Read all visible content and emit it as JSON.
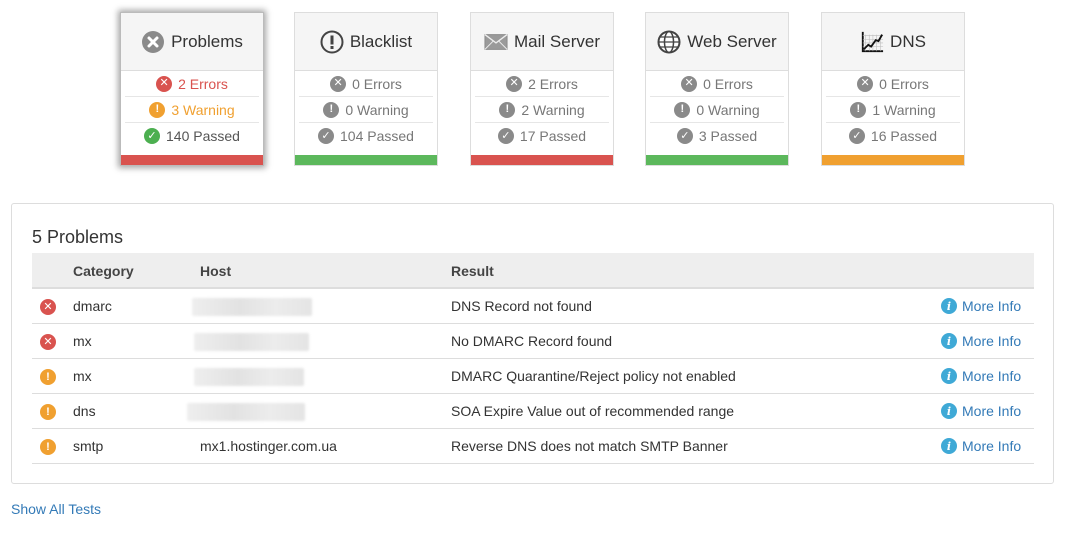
{
  "cards": [
    {
      "title": "Problems",
      "icon": "x-circle-icon",
      "selected": true,
      "errors": "2 Errors",
      "warnings": "3 Warning",
      "passed": "140 Passed",
      "status_color": "#d9534f",
      "errors_active": true,
      "warnings_active": true
    },
    {
      "title": "Blacklist",
      "icon": "exclamation-circle-icon",
      "selected": false,
      "errors": "0 Errors",
      "warnings": "0 Warning",
      "passed": "104 Passed",
      "status_color": "#5cb85c",
      "errors_active": false,
      "warnings_active": false
    },
    {
      "title": "Mail Server",
      "icon": "envelope-icon",
      "selected": false,
      "errors": "2 Errors",
      "warnings": "2 Warning",
      "passed": "17 Passed",
      "status_color": "#d9534f",
      "errors_active": false,
      "warnings_active": false
    },
    {
      "title": "Web Server",
      "icon": "globe-icon",
      "selected": false,
      "errors": "0 Errors",
      "warnings": "0 Warning",
      "passed": "3 Passed",
      "status_color": "#5cb85c",
      "errors_active": false,
      "warnings_active": false
    },
    {
      "title": "DNS",
      "icon": "chart-icon",
      "selected": false,
      "errors": "0 Errors",
      "warnings": "1 Warning",
      "passed": "16 Passed",
      "status_color": "#f0a030",
      "errors_active": false,
      "warnings_active": false
    }
  ],
  "problems": {
    "title": "5 Problems",
    "headers": {
      "category": "Category",
      "host": "Host",
      "result": "Result"
    },
    "more_info_label": "More Info",
    "rows": [
      {
        "severity": "error",
        "category": "dmarc",
        "host": "",
        "result": "DNS Record not found"
      },
      {
        "severity": "error",
        "category": "mx",
        "host": "",
        "result": "No DMARC Record found"
      },
      {
        "severity": "warning",
        "category": "mx",
        "host": "",
        "result": "DMARC Quarantine/Reject policy not enabled"
      },
      {
        "severity": "warning",
        "category": "dns",
        "host": "",
        "result": "SOA Expire Value out of recommended range"
      },
      {
        "severity": "warning",
        "category": "smtp",
        "host": "mx1.hostinger.com.ua",
        "result": "Reverse DNS does not match SMTP Banner"
      }
    ]
  },
  "show_all_label": "Show All Tests"
}
